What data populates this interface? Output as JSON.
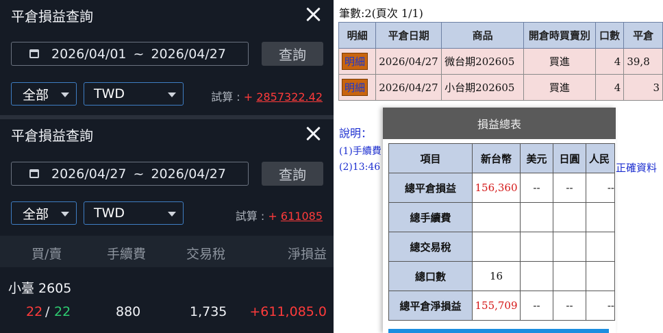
{
  "panel_a": {
    "title": "平倉損益查詢",
    "date_from": "2026/04/01",
    "tilde": "~",
    "date_to": "2026/04/27",
    "query_label": "查詢",
    "category": "全部",
    "currency": "TWD",
    "calc_label": "試算 :",
    "calc_sign": "+",
    "calc_value": "2857322.42"
  },
  "panel_b": {
    "title": "平倉損益查詢",
    "date_from": "2026/04/27",
    "tilde": "~",
    "date_to": "2026/04/27",
    "query_label": "查詢",
    "category": "全部",
    "currency": "TWD",
    "calc_label": "試算 :",
    "calc_sign": "+",
    "calc_value": "611085",
    "columns": [
      "買/賣",
      "手續費",
      "交易稅",
      "淨損益"
    ],
    "rows": [
      {
        "name": "小臺 2605",
        "buy": "22",
        "slash": "/",
        "sell": "22",
        "fee": "880",
        "tax": "1,735",
        "net": "+611,085.0"
      }
    ]
  },
  "right_page": {
    "count_text": "筆數:2(頁次 1/1)",
    "columns": [
      "明細",
      "平倉日期",
      "商品",
      "開倉時買賣別",
      "口數",
      "平倉"
    ],
    "rows": [
      {
        "detail": "明細",
        "date": "2026/04/27",
        "product": "微台期202605",
        "side": "買進",
        "qty": "4",
        "price": "39,8"
      },
      {
        "detail": "明細",
        "date": "2026/04/27",
        "product": "小台期202605",
        "side": "買進",
        "qty": "4",
        "price": "3"
      }
    ],
    "note_title": "說明：",
    "note_1": "(1)手續費",
    "note_2": "(2)13:46",
    "note_tail": "正確資料"
  },
  "summary_modal": {
    "title": "損益總表",
    "columns": [
      "項目",
      "新台幣",
      "美元",
      "日圓",
      "人民"
    ],
    "rows": [
      {
        "label": "總平倉損益",
        "twd": "156,360",
        "usd": "--",
        "jpy": "--",
        "cny": "--"
      },
      {
        "label": "總手續費",
        "twd": "",
        "usd": "",
        "jpy": "",
        "cny": ""
      },
      {
        "label": "總交易稅",
        "twd": "",
        "usd": "",
        "jpy": "",
        "cny": ""
      },
      {
        "label": "總口數",
        "twd": "16",
        "usd": "",
        "jpy": "",
        "cny": ""
      },
      {
        "label": "總平倉淨損益",
        "twd": "155,709",
        "usd": "--",
        "jpy": "--",
        "cny": "--"
      }
    ]
  },
  "colors": {
    "dark_bg": "#151b25",
    "profit_red": "#ff3b3b",
    "sell_green": "#2ecc71",
    "header_blue": "#c3d0e6",
    "row_pink": "#f6dcdc",
    "link_blue": "#1d2fd0"
  }
}
